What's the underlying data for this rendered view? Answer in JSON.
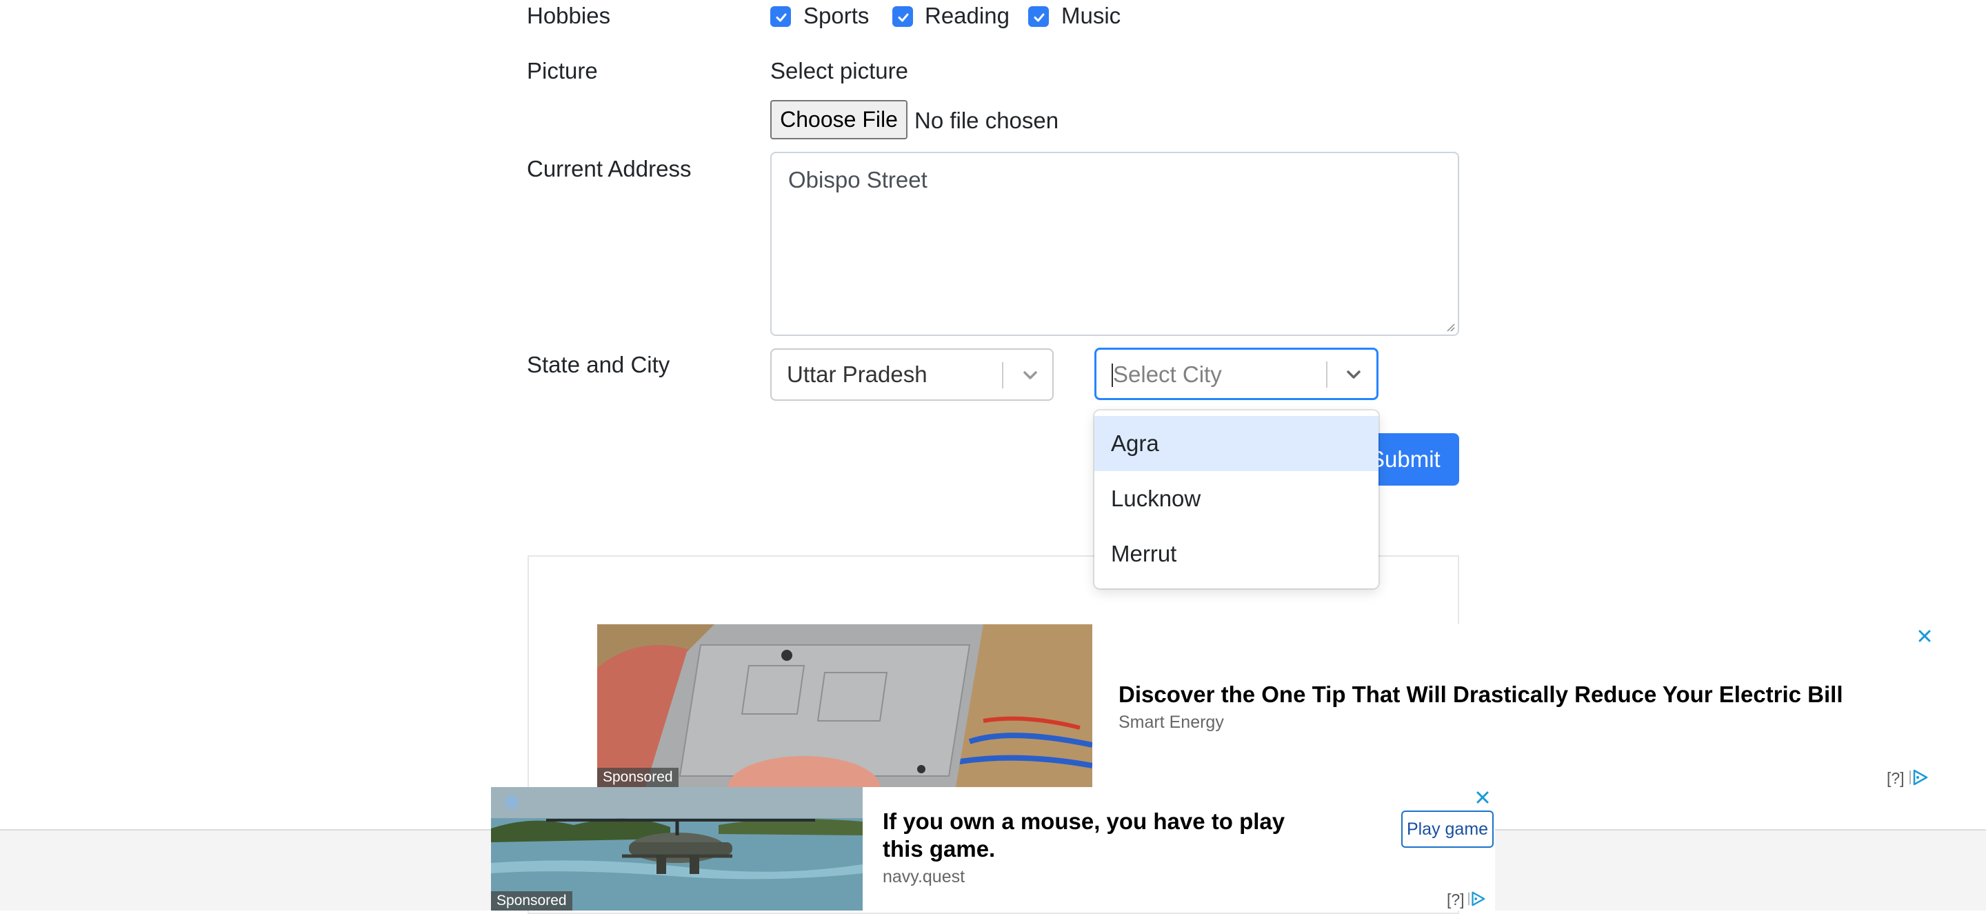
{
  "form": {
    "hobbies_label": "Hobbies",
    "hobbies": [
      {
        "label": "Sports",
        "checked": true
      },
      {
        "label": "Reading",
        "checked": true
      },
      {
        "label": "Music",
        "checked": true
      }
    ],
    "picture_label": "Picture",
    "picture_caption": "Select picture",
    "file_button": "Choose File",
    "file_status": "No file chosen",
    "address_label": "Current Address",
    "address_value": "Obispo Street",
    "state_city_label": "State and City",
    "state_value": "Uttar Pradesh",
    "city_placeholder": "Select City",
    "city_options": [
      "Agra",
      "Lucknow",
      "Merrut"
    ],
    "highlighted_option": "Agra",
    "submit_label": "Submit"
  },
  "ads": {
    "ad1": {
      "title": "Discover the One Tip That Will Drastically Reduce Your Electric Bill",
      "source": "Smart Energy",
      "sponsored": "Sponsored",
      "info": "[?]"
    },
    "ad2": {
      "title": "If you own a mouse, you have to play this game.",
      "source": "navy.quest",
      "button": "Play game",
      "sponsored": "Sponsored",
      "info": "[?]"
    }
  },
  "colors": {
    "accent": "#2f7df6",
    "option_highlight": "#deebff",
    "focus_border": "#2684ff"
  },
  "icons": [
    "check-icon",
    "chevron-down-icon",
    "close-icon",
    "adchoices-icon",
    "resize-grip-icon"
  ]
}
